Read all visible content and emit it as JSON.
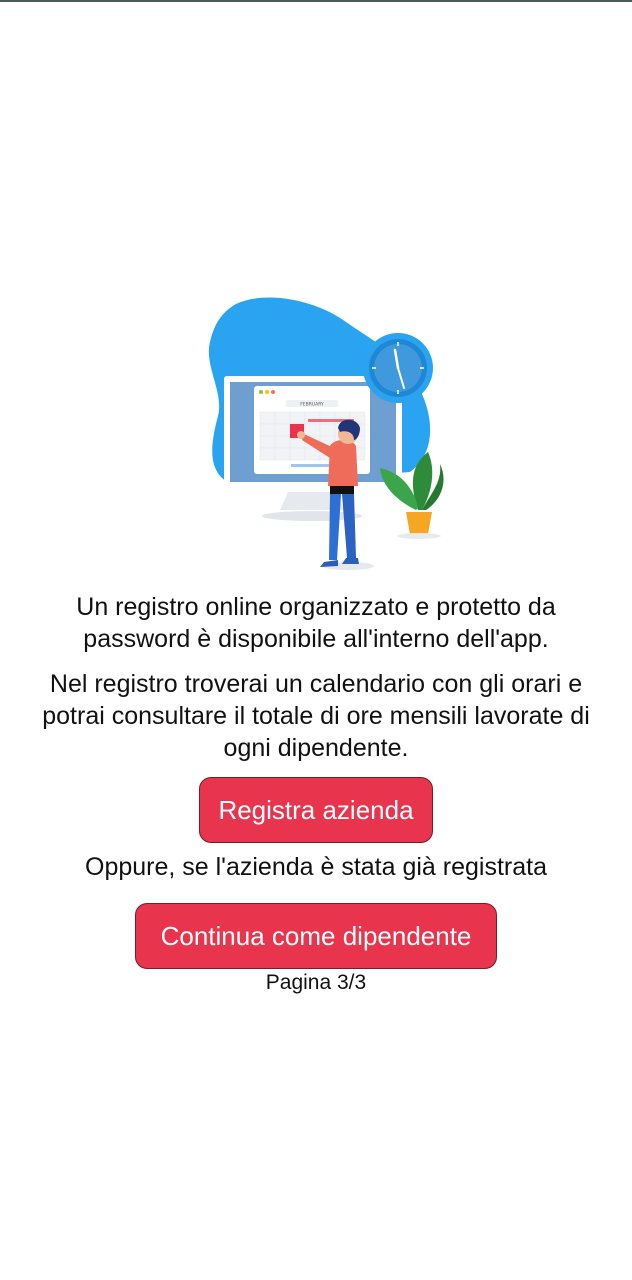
{
  "illustration": {
    "icon": "calendar-person-illustration",
    "calendar_month": "FEBRUARY"
  },
  "intro": {
    "line1": "Un registro online organizzato e protetto da",
    "line2": "password è disponibile all'interno dell'app.",
    "detail_line1": "Nel registro troverai un calendario con gli orari e",
    "detail_line2": "potrai consultare il totale di ore mensili lavorate di",
    "detail_line3": "ogni dipendente."
  },
  "actions": {
    "register_label": "Registra azienda",
    "or_text": "Oppure, se l'azienda è stata già registrata",
    "continue_label": "Continua come dipendente"
  },
  "pagination": {
    "label": "Pagina 3/3"
  },
  "colors": {
    "accent": "#e8354d",
    "illustration_blue": "#2aa4f0"
  }
}
